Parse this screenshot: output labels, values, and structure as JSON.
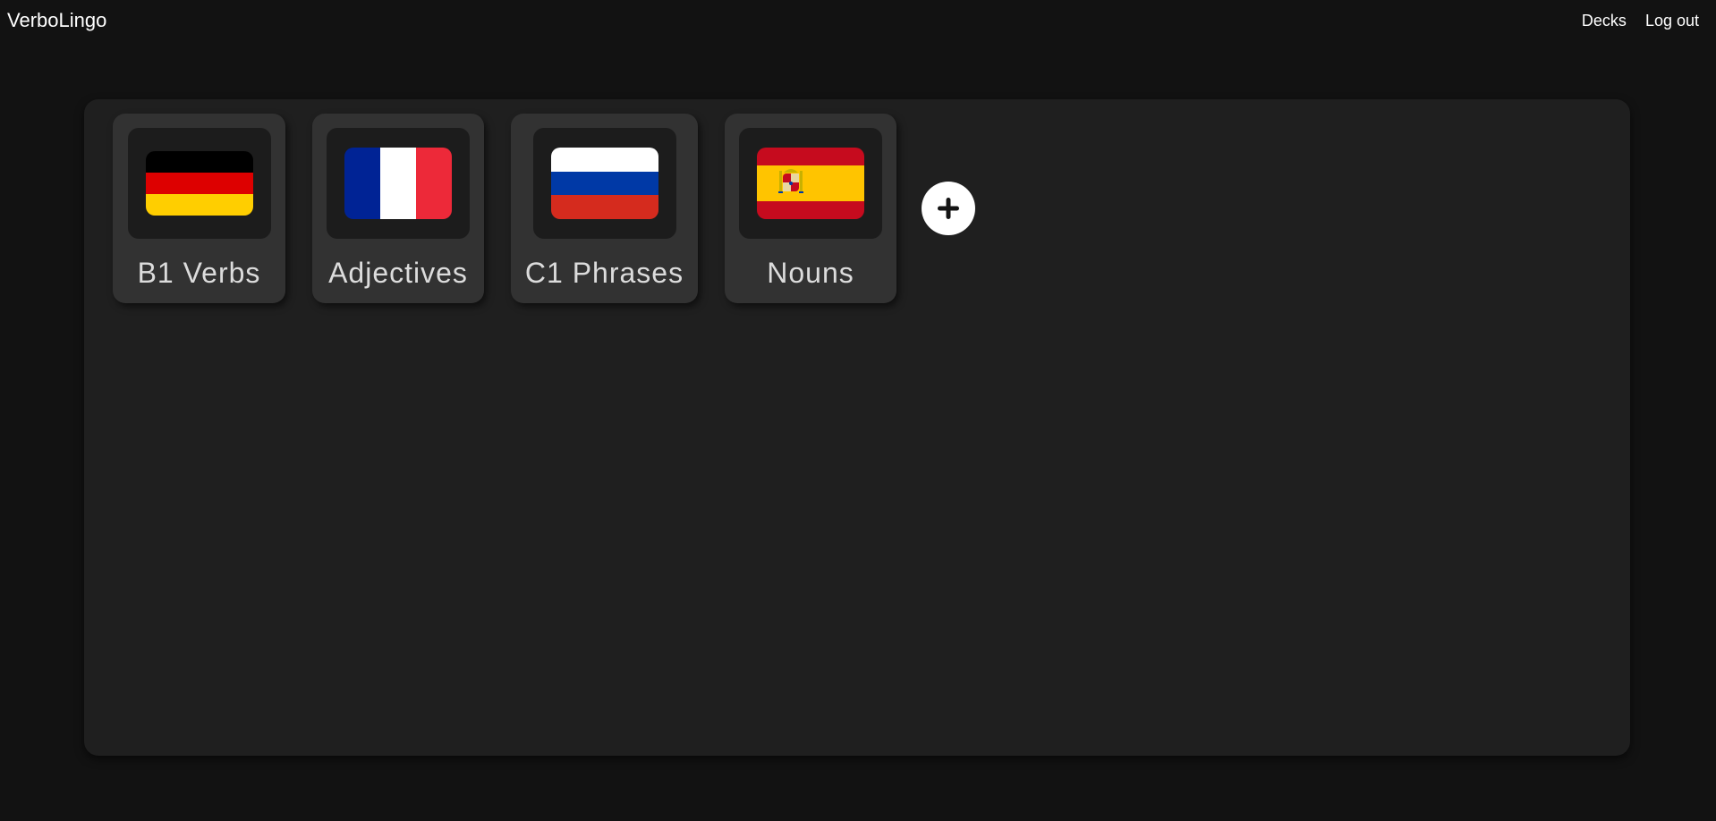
{
  "header": {
    "brand": "VerboLingo",
    "nav": [
      {
        "label": "Decks"
      },
      {
        "label": "Log out"
      }
    ]
  },
  "decks": [
    {
      "label": "B1 Verbs",
      "flag_icon": "germany-flag-icon",
      "colors": [
        "#000000",
        "#dd0000",
        "#ffce00"
      ]
    },
    {
      "label": "Adjectives",
      "flag_icon": "france-flag-icon",
      "colors": [
        "#002395",
        "#ffffff",
        "#ed2939"
      ]
    },
    {
      "label": "C1 Phrases",
      "flag_icon": "russia-flag-icon",
      "colors": [
        "#ffffff",
        "#0039a6",
        "#d52b1e"
      ]
    },
    {
      "label": "Nouns",
      "flag_icon": "spain-flag-icon",
      "colors": [
        "#c60b1e",
        "#ffc400",
        "#c60b1e"
      ]
    }
  ],
  "add_button": {
    "icon": "plus-icon"
  },
  "colors": {
    "background": "#121212",
    "panel": "#1f1f1f",
    "card": "#323232",
    "flag_frame": "#1c1c1c",
    "text": "#ffffff",
    "card_text": "#dcdcdc"
  }
}
